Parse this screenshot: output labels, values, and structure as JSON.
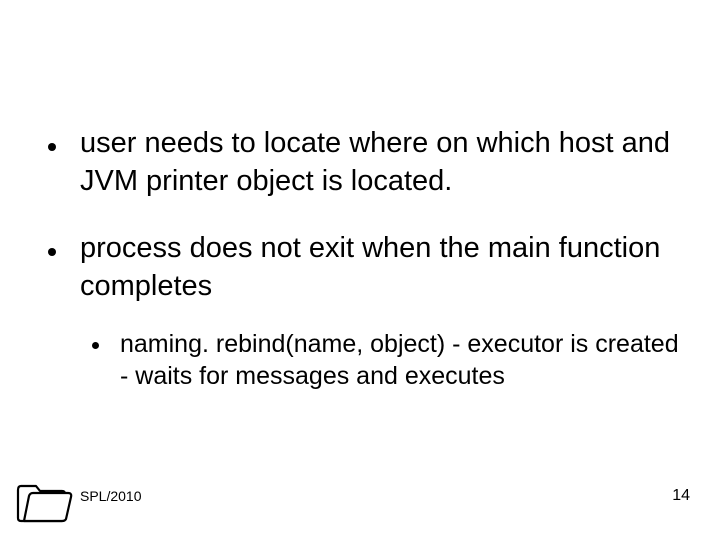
{
  "bullets": [
    {
      "text": "user needs to locate where on which host and JVM printer object is located."
    },
    {
      "text": "process does not exit when the main function completes",
      "sub": [
        {
          "text": "naming. rebind(name, object)  - executor is created - waits for messages and executes"
        }
      ]
    }
  ],
  "footer": {
    "label": "SPL/2010"
  },
  "page_number": "14"
}
